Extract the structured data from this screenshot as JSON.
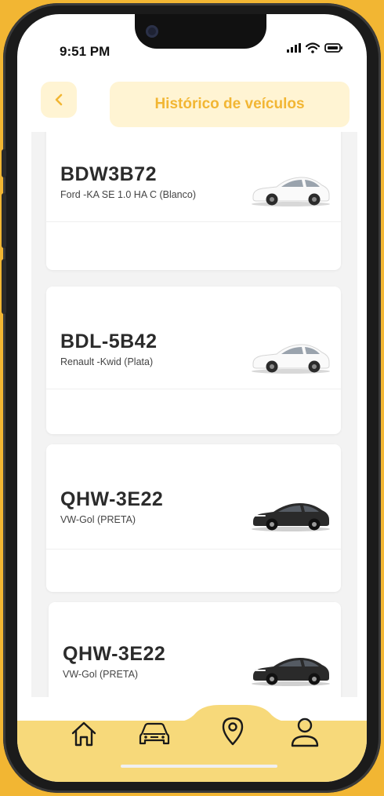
{
  "status_bar": {
    "time": "9:51 PM"
  },
  "header": {
    "title": "Histórico de veículos",
    "back_icon": "chevron-left-icon"
  },
  "vehicles": [
    {
      "plate": "BDW3B72",
      "model": "Ford -KA SE 1.0 HA C (Blanco)",
      "car_color": "white"
    },
    {
      "plate": "BDL-5B42",
      "model": "Renault -Kwid (Plata)",
      "car_color": "white"
    },
    {
      "plate": "QHW-3E22",
      "model": "VW-Gol (PRETA)",
      "car_color": "black"
    },
    {
      "plate": "QHW-3E22",
      "model": "VW-Gol (PRETA)",
      "car_color": "black"
    }
  ],
  "bottom_nav": {
    "items": [
      {
        "icon": "home-icon",
        "active": false
      },
      {
        "icon": "car-icon",
        "active": false
      },
      {
        "icon": "location-pin-icon",
        "active": true
      },
      {
        "icon": "user-icon",
        "active": false
      }
    ]
  },
  "colors": {
    "accent": "#F2B633",
    "accent_light": "#FFF4D3",
    "nav_bg": "#F7D97A"
  }
}
